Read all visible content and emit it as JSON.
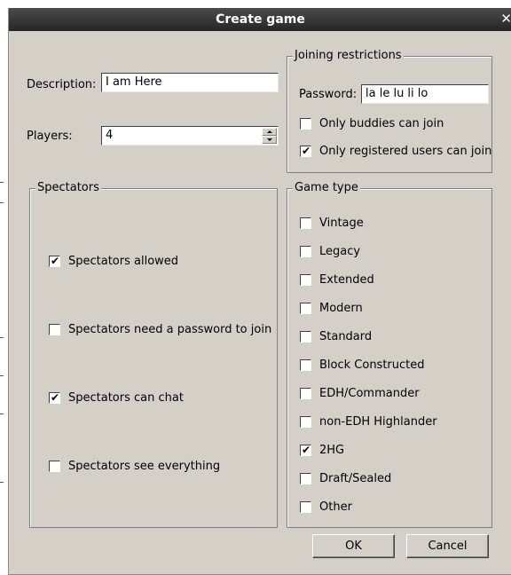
{
  "window": {
    "title": "Create game"
  },
  "form": {
    "description_label": "Description:",
    "description_value": "I am Here",
    "players_label": "Players:",
    "players_value": "4"
  },
  "joining": {
    "title": "Joining restrictions",
    "password_label": "Password:",
    "password_value": "la le lu li lo",
    "options": [
      {
        "label": "Only buddies can join",
        "checked": false
      },
      {
        "label": "Only registered users can join",
        "checked": true
      }
    ]
  },
  "spectators": {
    "title": "Spectators",
    "options": [
      {
        "label": "Spectators allowed",
        "checked": true
      },
      {
        "label": "Spectators need a password to join",
        "checked": false
      },
      {
        "label": "Spectators can chat",
        "checked": true
      },
      {
        "label": "Spectators see everything",
        "checked": false
      }
    ]
  },
  "game_type": {
    "title": "Game type",
    "options": [
      {
        "label": "Vintage",
        "checked": false
      },
      {
        "label": "Legacy",
        "checked": false
      },
      {
        "label": "Extended",
        "checked": false
      },
      {
        "label": "Modern",
        "checked": false
      },
      {
        "label": "Standard",
        "checked": false
      },
      {
        "label": "Block Constructed",
        "checked": false
      },
      {
        "label": "EDH/Commander",
        "checked": false
      },
      {
        "label": "non-EDH Highlander",
        "checked": false
      },
      {
        "label": "2HG",
        "checked": true
      },
      {
        "label": "Draft/Sealed",
        "checked": false
      },
      {
        "label": "Other",
        "checked": false
      }
    ]
  },
  "buttons": {
    "ok_label": "OK",
    "cancel_label": "Cancel"
  },
  "icons": {
    "close": "close-icon",
    "checkmark": "checkmark-icon",
    "spin_up": "spin-up-icon",
    "spin_down": "spin-down-icon"
  }
}
